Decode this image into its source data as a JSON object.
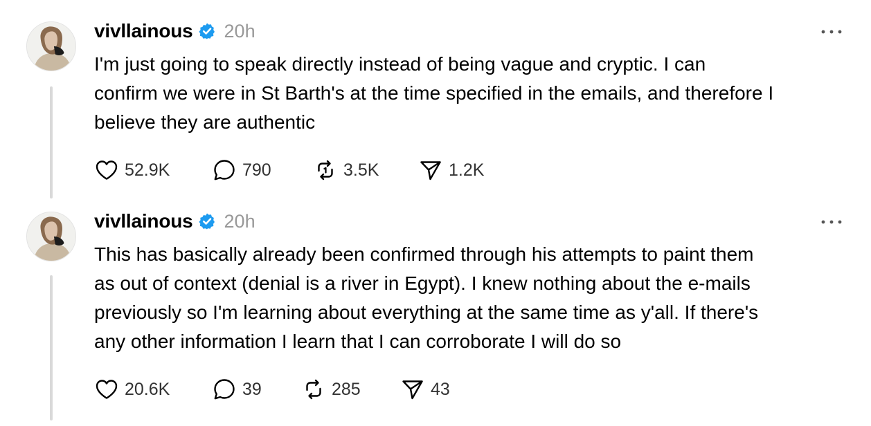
{
  "posts": [
    {
      "username": "vivllainous",
      "verified_icon": "verified-badge-icon",
      "time": "20h",
      "text": "I'm just going to speak directly instead of being vague and cryptic. I can\nconfirm we were in St Barth's at the time specified in the emails, and therefore I\nbelieve they are authentic",
      "likes": "52.9K",
      "replies": "790",
      "reposts": "3.5K",
      "shares": "1.2K"
    },
    {
      "username": "vivllainous",
      "verified_icon": "verified-badge-icon",
      "time": "20h",
      "text": "This has basically already been confirmed through his attempts to paint them\nas out of context (denial is a river in Egypt). I knew nothing about the e-mails\npreviously so I'm learning about everything at the same time as y'all. If there's\nany other information I learn that I can corroborate I will do so",
      "likes": "20.6K",
      "replies": "39",
      "reposts": "285",
      "shares": "43"
    }
  ],
  "colors": {
    "verified_blue": "#1d9bf0",
    "timestamp_gray": "#999999",
    "thread_line": "#d9d9d9",
    "icon_stroke": "#000000"
  },
  "icons": [
    "heart-icon",
    "comment-icon",
    "repost-icon",
    "send-icon",
    "more-options-icon"
  ]
}
